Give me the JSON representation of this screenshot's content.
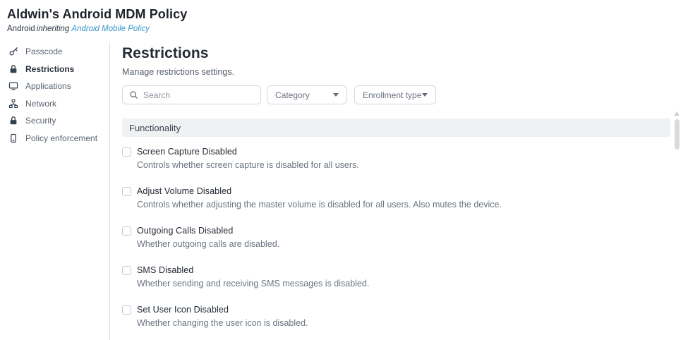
{
  "header": {
    "title": "Aldwin's Android MDM Policy",
    "platform": "Android",
    "inheriting_label": "inheriting",
    "inherited_policy_link": "Android Mobile Policy"
  },
  "sidebar": {
    "items": [
      {
        "label": "Passcode",
        "icon": "key-icon",
        "active": false
      },
      {
        "label": "Restrictions",
        "icon": "lock-icon",
        "active": true
      },
      {
        "label": "Applications",
        "icon": "monitor-icon",
        "active": false
      },
      {
        "label": "Network",
        "icon": "network-icon",
        "active": false
      },
      {
        "label": "Security",
        "icon": "lock-icon",
        "active": false
      },
      {
        "label": "Policy enforcement",
        "icon": "smartphone-icon",
        "active": false
      }
    ]
  },
  "main": {
    "title": "Restrictions",
    "subtitle": "Manage restrictions settings.",
    "filters": {
      "search_placeholder": "Search",
      "category_label": "Category",
      "enrollment_type_label": "Enrollment type"
    },
    "section": {
      "title": "Functionality",
      "settings": [
        {
          "label": "Screen Capture Disabled",
          "description": "Controls whether screen capture is disabled for all users.",
          "checked": false
        },
        {
          "label": "Adjust Volume Disabled",
          "description": "Controls whether adjusting the master volume is disabled for all users. Also mutes the device.",
          "checked": false
        },
        {
          "label": "Outgoing Calls Disabled",
          "description": "Whether outgoing calls are disabled.",
          "checked": false
        },
        {
          "label": "SMS Disabled",
          "description": "Whether sending and receiving SMS messages is disabled.",
          "checked": false
        },
        {
          "label": "Set User Icon Disabled",
          "description": "Whether changing the user icon is disabled.",
          "checked": false
        }
      ]
    }
  },
  "colors": {
    "link": "#3695cb",
    "section_header_bg": "#f0f1f3",
    "sidebar_icon": "#33404f",
    "border": "#d5d9de"
  }
}
